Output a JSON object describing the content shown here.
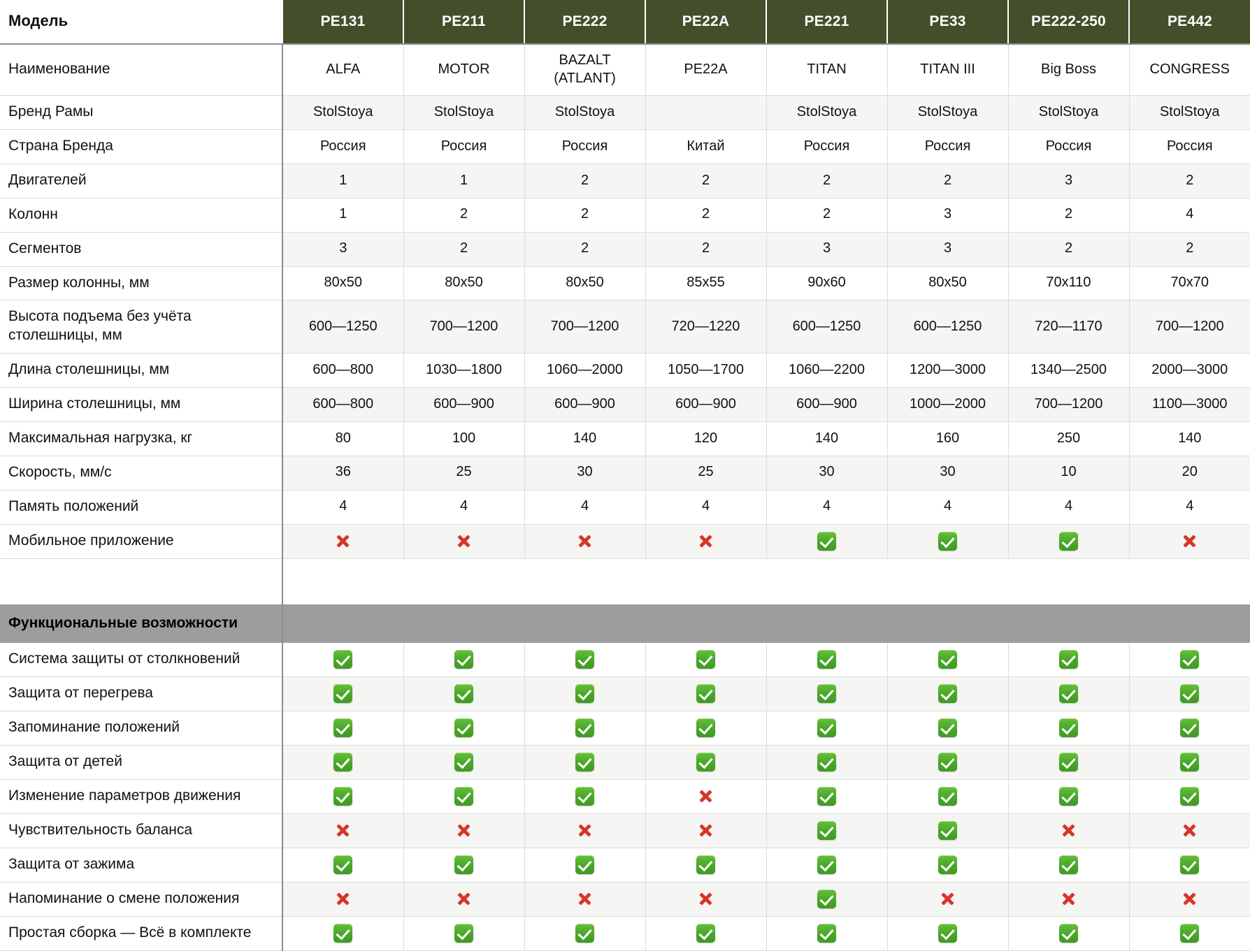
{
  "table": {
    "label_header": "Модель",
    "columns": [
      {
        "model": "PE131"
      },
      {
        "model": "PE211"
      },
      {
        "model": "PE222"
      },
      {
        "model": "PE22A"
      },
      {
        "model": "PE221"
      },
      {
        "model": "PE33"
      },
      {
        "model": "PE222-250"
      },
      {
        "model": "PE442"
      }
    ],
    "spec_rows": [
      {
        "label": "Наименование",
        "values": [
          "ALFA",
          "MOTOR",
          "BAZALT\n(ATLANT)",
          "PE22A",
          "TITAN",
          "TITAN III",
          "Big Boss",
          "CONGRESS"
        ]
      },
      {
        "label": "Бренд Рамы",
        "values": [
          "StolStoya",
          "StolStoya",
          "StolStoya",
          "",
          "StolStoya",
          "StolStoya",
          "StolStoya",
          "StolStoya"
        ]
      },
      {
        "label": "Страна Бренда",
        "values": [
          "Россия",
          "Россия",
          "Россия",
          "Китай",
          "Россия",
          "Россия",
          "Россия",
          "Россия"
        ]
      },
      {
        "label": "Двигателей",
        "values": [
          "1",
          "1",
          "2",
          "2",
          "2",
          "2",
          "3",
          "2"
        ]
      },
      {
        "label": "Колонн",
        "values": [
          "1",
          "2",
          "2",
          "2",
          "2",
          "3",
          "2",
          "4"
        ]
      },
      {
        "label": "Сегментов",
        "values": [
          "3",
          "2",
          "2",
          "2",
          "3",
          "3",
          "2",
          "2"
        ]
      },
      {
        "label": "Размер колонны, мм",
        "values": [
          "80x50",
          "80x50",
          "80x50",
          "85x55",
          "90x60",
          "80x50",
          "70x110",
          "70x70"
        ]
      },
      {
        "label": "Высота подъема без учёта столешницы, мм",
        "values": [
          "600—1250",
          "700—1200",
          "700—1200",
          "720—1220",
          "600—1250",
          "600—1250",
          "720—1170",
          "700—1200"
        ]
      },
      {
        "label": "Длина столешницы, мм",
        "values": [
          "600—800",
          "1030—1800",
          "1060—2000",
          "1050—1700",
          "1060—2200",
          "1200—3000",
          "1340—2500",
          "2000—3000"
        ]
      },
      {
        "label": "Ширина столешницы, мм",
        "values": [
          "600—800",
          "600—900",
          "600—900",
          "600—900",
          "600—900",
          "1000—2000",
          "700—1200",
          "1100—3000"
        ]
      },
      {
        "label": "Максимальная нагрузка, кг",
        "values": [
          "80",
          "100",
          "140",
          "120",
          "140",
          "160",
          "250",
          "140"
        ]
      },
      {
        "label": "Скорость, мм/с",
        "values": [
          "36",
          "25",
          "30",
          "25",
          "30",
          "30",
          "10",
          "20"
        ]
      },
      {
        "label": "Память положений",
        "values": [
          "4",
          "4",
          "4",
          "4",
          "4",
          "4",
          "4",
          "4"
        ]
      },
      {
        "label": "Мобильное приложение",
        "values": [
          "cross",
          "cross",
          "cross",
          "cross",
          "check",
          "check",
          "check",
          "cross"
        ]
      }
    ],
    "section_title": "Функциональные возможности",
    "feature_rows": [
      {
        "label": "Система защиты от столкновений",
        "values": [
          "check",
          "check",
          "check",
          "check",
          "check",
          "check",
          "check",
          "check"
        ]
      },
      {
        "label": "Защита от перегрева",
        "values": [
          "check",
          "check",
          "check",
          "check",
          "check",
          "check",
          "check",
          "check"
        ]
      },
      {
        "label": "Запоминание положений",
        "values": [
          "check",
          "check",
          "check",
          "check",
          "check",
          "check",
          "check",
          "check"
        ]
      },
      {
        "label": "Защита от детей",
        "values": [
          "check",
          "check",
          "check",
          "check",
          "check",
          "check",
          "check",
          "check"
        ]
      },
      {
        "label": "Изменение параметров движения",
        "values": [
          "check",
          "check",
          "check",
          "cross",
          "check",
          "check",
          "check",
          "check"
        ]
      },
      {
        "label": "Чувствительность баланса",
        "values": [
          "cross",
          "cross",
          "cross",
          "cross",
          "check",
          "check",
          "cross",
          "cross"
        ]
      },
      {
        "label": "Защита от зажима",
        "values": [
          "check",
          "check",
          "check",
          "check",
          "check",
          "check",
          "check",
          "check"
        ]
      },
      {
        "label": "Напоминание о смене положения",
        "values": [
          "cross",
          "cross",
          "cross",
          "cross",
          "check",
          "cross",
          "cross",
          "cross"
        ]
      },
      {
        "label": "Простая сборка — Всё в комплекте",
        "values": [
          "check",
          "check",
          "check",
          "check",
          "check",
          "check",
          "check",
          "check"
        ]
      }
    ]
  },
  "icons": {
    "check": "green-check-box-icon",
    "cross": "red-cross-icon"
  },
  "colors": {
    "header_bg": "#434f2a",
    "header_text": "#ffffff",
    "section_bg": "#9d9d9d",
    "zebra_bg": "#f5f5f3",
    "check_green": "#4aa82a",
    "cross_red": "#d8352a",
    "grid_line": "#dcdcdc",
    "divider": "#8d8d8d"
  }
}
